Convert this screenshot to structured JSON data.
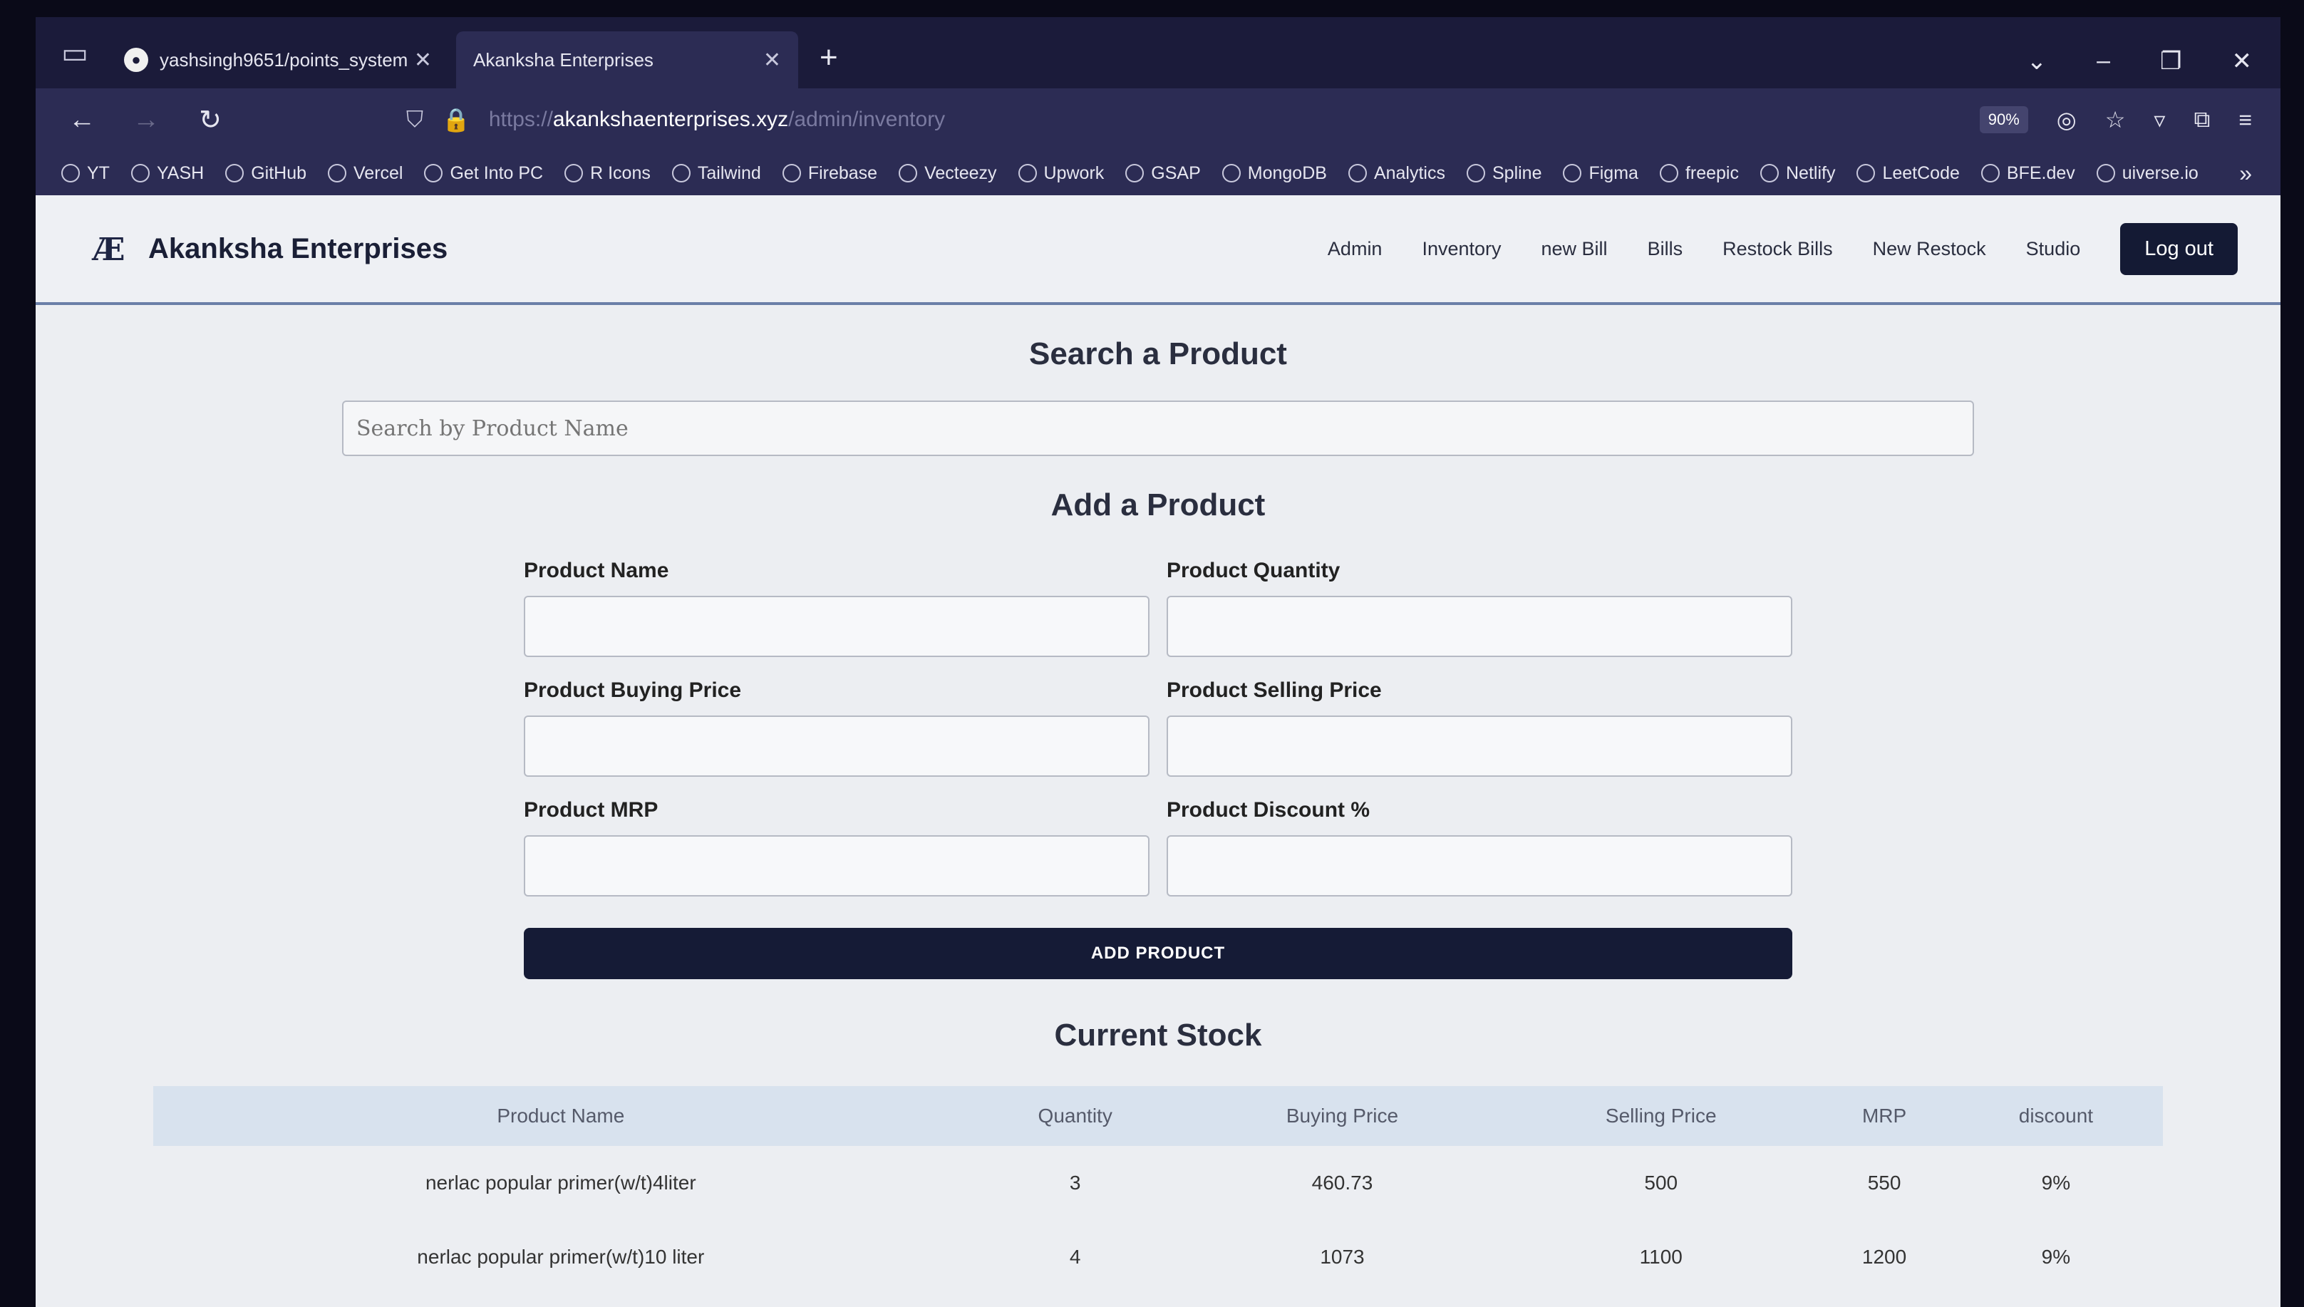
{
  "browser": {
    "tabs": [
      {
        "title": "yashsingh9651/points_system",
        "favicon": "github-icon",
        "active": false
      },
      {
        "title": "Akanksha Enterprises",
        "favicon": "",
        "active": true
      }
    ],
    "new_tab": "+",
    "url_host": "akankshaenterprises.xyz",
    "url_path": "/admin/inventory",
    "url_scheme": "https://",
    "zoom": "90%",
    "bookmarks": [
      "YT",
      "YASH",
      "GitHub",
      "Vercel",
      "Get Into PC",
      "R Icons",
      "Tailwind",
      "Firebase",
      "Vecteezy",
      "Upwork",
      "GSAP",
      "MongoDB",
      "Analytics",
      "Spline",
      "Figma",
      "freepic",
      "Netlify",
      "LeetCode",
      "BFE.dev",
      "uiverse.io"
    ]
  },
  "header": {
    "brand": "Akanksha Enterprises",
    "menu": [
      "Admin",
      "Inventory",
      "new Bill",
      "Bills",
      "Restock Bills",
      "New Restock",
      "Studio"
    ],
    "logout": "Log out"
  },
  "search": {
    "title": "Search a Product",
    "placeholder": "Search by Product Name"
  },
  "add_form": {
    "title": "Add a Product",
    "fields": {
      "name": "Product Name",
      "quantity": "Product Quantity",
      "buying_price": "Product Buying Price",
      "selling_price": "Product Selling Price",
      "mrp": "Product MRP",
      "discount": "Product Discount %"
    },
    "submit": "ADD PRODUCT"
  },
  "stock": {
    "title": "Current Stock",
    "columns": [
      "Product Name",
      "Quantity",
      "Buying Price",
      "Selling Price",
      "MRP",
      "discount"
    ],
    "rows": [
      [
        "nerlac popular primer(w/t)4liter",
        "3",
        "460.73",
        "500",
        "550",
        "9%"
      ],
      [
        "nerlac popular primer(w/t)10 liter",
        "4",
        "1073",
        "1100",
        "1200",
        "9%"
      ]
    ]
  },
  "colors": {
    "primary_button": "#151b36",
    "header_border": "#6b7fa8",
    "table_header": "#d8e2ee"
  }
}
